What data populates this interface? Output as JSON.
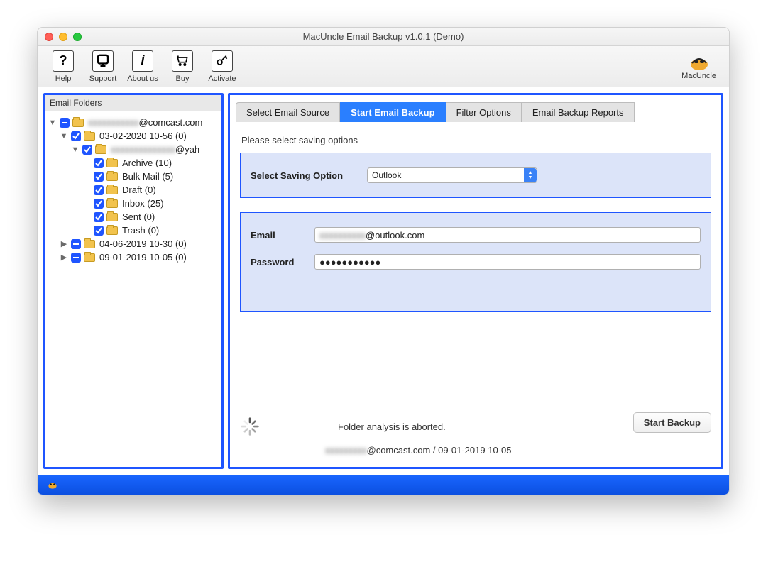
{
  "window_title": "MacUncle Email Backup v1.0.1 (Demo)",
  "toolbar": {
    "help": "Help",
    "support": "Support",
    "about": "About us",
    "buy": "Buy",
    "activate": "Activate",
    "brand": "MacUncle"
  },
  "left": {
    "header": "Email Folders",
    "root": "@comcast.com",
    "node1": "03-02-2020 10-56 (0)",
    "node1a": "@yah",
    "archive": "Archive (10)",
    "bulk": "Bulk Mail (5)",
    "draft": "Draft (0)",
    "inbox": "Inbox (25)",
    "sent": "Sent (0)",
    "trash": "Trash (0)",
    "node2": "04-06-2019 10-30 (0)",
    "node3": "09-01-2019 10-05 (0)"
  },
  "tabs": {
    "t1": "Select Email Source",
    "t2": "Start Email Backup",
    "t3": "Filter Options",
    "t4": "Email Backup Reports"
  },
  "panel": {
    "instruct": "Please select saving options",
    "saving_label": "Select Saving Option",
    "saving_value": "Outlook",
    "email_label": "Email",
    "email_value": "@outlook.com",
    "password_label": "Password",
    "password_value": "●●●●●●●●●●●"
  },
  "footer": {
    "status": "Folder analysis is aborted.",
    "path": "@comcast.com / 09-01-2019 10-05",
    "start_btn": "Start Backup"
  }
}
